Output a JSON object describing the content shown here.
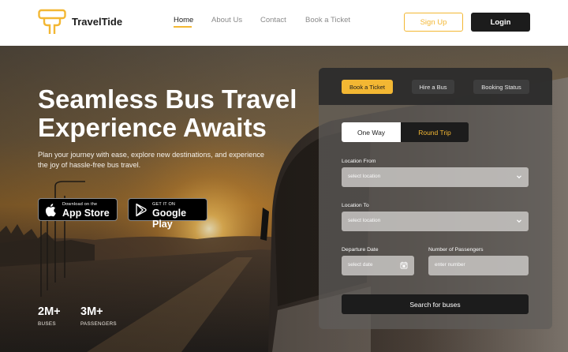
{
  "brand": {
    "name": "TravelTide"
  },
  "nav": {
    "links": [
      {
        "label": "Home"
      },
      {
        "label": "About Us"
      },
      {
        "label": "Contact"
      },
      {
        "label": "Book a Ticket"
      }
    ],
    "signup_label": "Sign Up",
    "login_label": "Login"
  },
  "hero": {
    "headline_line1": "Seamless Bus Travel",
    "headline_line2": "Experience Awaits",
    "subtext": "Plan your journey with ease, explore new destinations, and experience the joy of hassle-free bus travel."
  },
  "stores": {
    "apple": {
      "small": "Download on the",
      "big": "App Store"
    },
    "google": {
      "small": "GET IT ON",
      "big": "Google Play"
    }
  },
  "stats": [
    {
      "value": "2M+",
      "label": "BUSES"
    },
    {
      "value": "3M+",
      "label": "PASSENGERS"
    }
  ],
  "booking": {
    "tabs": [
      {
        "label": "Book a Ticket"
      },
      {
        "label": "Hire a Bus"
      },
      {
        "label": "Booking Status"
      }
    ],
    "trip_types": [
      {
        "label": "One Way"
      },
      {
        "label": "Round Trip"
      }
    ],
    "from": {
      "label": "Location From",
      "placeholder": "select location"
    },
    "to": {
      "label": "Location To",
      "placeholder": "select location"
    },
    "date": {
      "label": "Departure Date",
      "placeholder": "select date"
    },
    "passengers": {
      "label": "Number of Passengers",
      "placeholder": "enter number"
    },
    "search_label": "Search for buses"
  },
  "colors": {
    "accent": "#f3b733",
    "dark": "#1c1c1c"
  },
  "icons": [
    "traveltide-logo-icon",
    "apple-icon",
    "google-play-icon",
    "chevron-down-icon",
    "calendar-icon"
  ]
}
